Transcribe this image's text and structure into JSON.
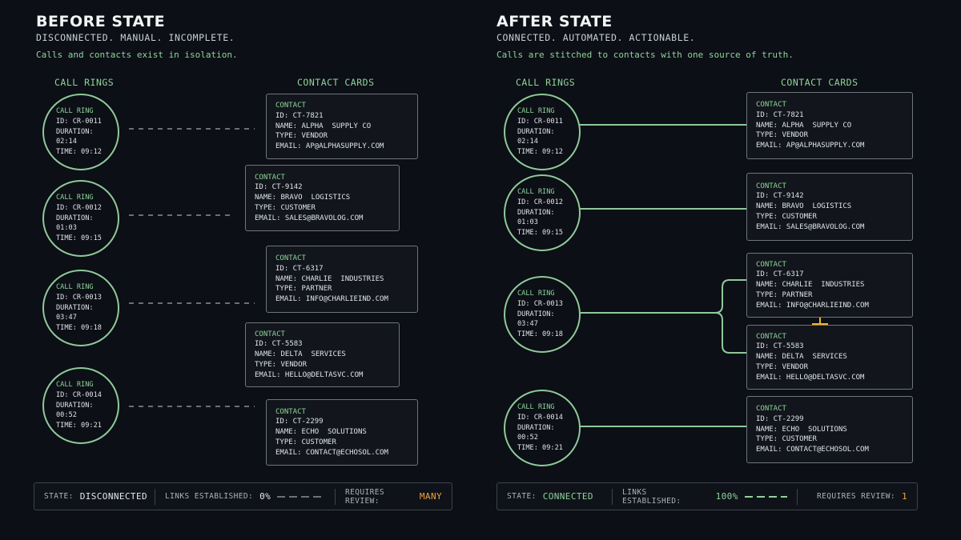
{
  "before": {
    "title": "BEFORE STATE",
    "subtitle": "DISCONNECTED. MANUAL. INCOMPLETE.",
    "description": "Calls and contacts exist in isolation.",
    "rings_header": "CALL RINGS",
    "cards_header": "CONTACT CARDS",
    "status": {
      "state_label": "STATE:",
      "state_value": "DISCONNECTED",
      "links_label": "LINKS ESTABLISHED:",
      "links_value": "0%",
      "review_label": "REQUIRES REVIEW:",
      "review_value": "MANY"
    }
  },
  "after": {
    "title": "AFTER STATE",
    "subtitle": "CONNECTED. AUTOMATED. ACTIONABLE.",
    "description": "Calls are stitched to contacts with one source of truth.",
    "rings_header": "CALL RINGS",
    "cards_header": "CONTACT CARDS",
    "status": {
      "state_label": "STATE:",
      "state_value": "CONNECTED",
      "links_label": "LINKS ESTABLISHED:",
      "links_value": "100%",
      "review_label": "REQUIRES REVIEW:",
      "review_value": "1"
    }
  },
  "rings": [
    {
      "label": "CALL RING",
      "id": "ID: CR-0011",
      "duration": "DURATION: 02:14",
      "time": "TIME: 09:12"
    },
    {
      "label": "CALL RING",
      "id": "ID: CR-0012",
      "duration": "DURATION: 01:03",
      "time": "TIME: 09:15"
    },
    {
      "label": "CALL RING",
      "id": "ID: CR-0013",
      "duration": "DURATION: 03:47",
      "time": "TIME: 09:18"
    },
    {
      "label": "CALL RING",
      "id": "ID: CR-0014",
      "duration": "DURATION: 00:52",
      "time": "TIME: 09:21"
    }
  ],
  "contacts": [
    {
      "label": "CONTACT",
      "id": "ID: CT-7821",
      "name": "NAME: ALPHA  SUPPLY CO",
      "type": "TYPE: VENDOR",
      "email": "EMAIL: AP@ALPHASUPPLY.COM"
    },
    {
      "label": "CONTACT",
      "id": "ID: CT-9142",
      "name": "NAME: BRAVO  LOGISTICS",
      "type": "TYPE: CUSTOMER",
      "email": "EMAIL: SALES@BRAVOLOG.COM"
    },
    {
      "label": "CONTACT",
      "id": "ID: CT-6317",
      "name": "NAME: CHARLIE  INDUSTRIES",
      "type": "TYPE: PARTNER",
      "email": "EMAIL: INFO@CHARLIEIND.COM"
    },
    {
      "label": "CONTACT",
      "id": "ID: CT-5583",
      "name": "NAME: DELTA  SERVICES",
      "type": "TYPE: VENDOR",
      "email": "EMAIL: HELLO@DELTASVC.COM"
    },
    {
      "label": "CONTACT",
      "id": "ID: CT-2299",
      "name": "NAME: ECHO  SOLUTIONS",
      "type": "TYPE: CUSTOMER",
      "email": "EMAIL: CONTACT@ECHOSOL.COM"
    }
  ],
  "colors": {
    "background": "#0c0f15",
    "accent_green": "#8fd39b",
    "ring_stroke": "#8fc99a",
    "card_border": "#6e757c",
    "warning_orange": "#f0a23a",
    "review_marker": "#f2b42e"
  },
  "icons": {
    "review_marker": "plus-marker-icon",
    "links_indicator": "dash-line-icon"
  }
}
